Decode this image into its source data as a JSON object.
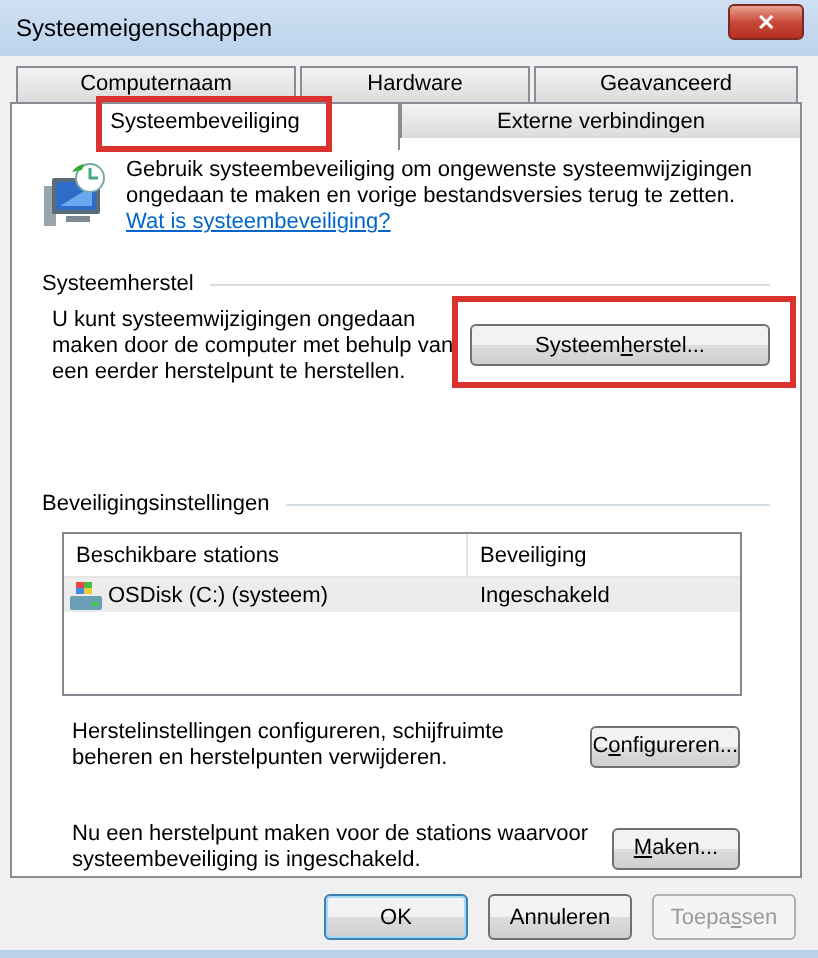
{
  "window": {
    "title": "Systeemeigenschappen",
    "close": "✕"
  },
  "tab_rows": [
    [
      {
        "label": "Computernaam",
        "selected": false,
        "highlight": false
      },
      {
        "label": "Hardware",
        "selected": false,
        "highlight": false
      },
      {
        "label": "Geavanceerd",
        "selected": false,
        "highlight": false
      }
    ],
    [
      {
        "label": "Systeembeveiliging",
        "selected": true,
        "highlight": true
      },
      {
        "label": "Externe verbindingen",
        "selected": false,
        "highlight": false
      }
    ]
  ],
  "intro": {
    "text": "Gebruik systeembeveiliging om ongewenste systeemwijzigingen ongedaan te maken en vorige bestandsversies terug te zetten.",
    "link": "Wat is systeembeveiliging?"
  },
  "restore": {
    "heading": "Systeemherstel",
    "text": "U kunt systeemwijzigingen ongedaan maken door de computer met behulp van een eerder herstelpunt te herstellen.",
    "button": {
      "label": {
        "before": "Systeem",
        "key": "h",
        "after": "erstel..."
      },
      "highlight": true,
      "disabled": false
    }
  },
  "protection": {
    "heading": "Beveiligingsinstellingen",
    "columns": [
      "Beschikbare stations",
      "Beveiliging"
    ],
    "rows": [
      {
        "cells": [
          "OSDisk (C:) (systeem)",
          "Ingeschakeld"
        ],
        "selected": true
      }
    ],
    "actions": [
      {
        "text": "Herstelinstellingen configureren, schijfruimte beheren en herstelpunten verwijderen.",
        "button": {
          "label": {
            "before": "C",
            "key": "o",
            "after": "nfigureren..."
          },
          "disabled": false
        }
      },
      {
        "text": "Nu een herstelpunt maken voor de stations waarvoor systeembeveiliging is ingeschakeld.",
        "button": {
          "label": {
            "key": "M",
            "after": "aken..."
          },
          "disabled": false
        }
      }
    ]
  },
  "buttons": [
    {
      "label": {
        "before": "OK"
      },
      "default": true,
      "disabled": false
    },
    {
      "label": {
        "before": "Annuleren"
      },
      "default": false,
      "disabled": false
    },
    {
      "label": {
        "before": "Toepa",
        "key": "s",
        "after": "sen"
      },
      "default": false,
      "disabled": true
    }
  ]
}
